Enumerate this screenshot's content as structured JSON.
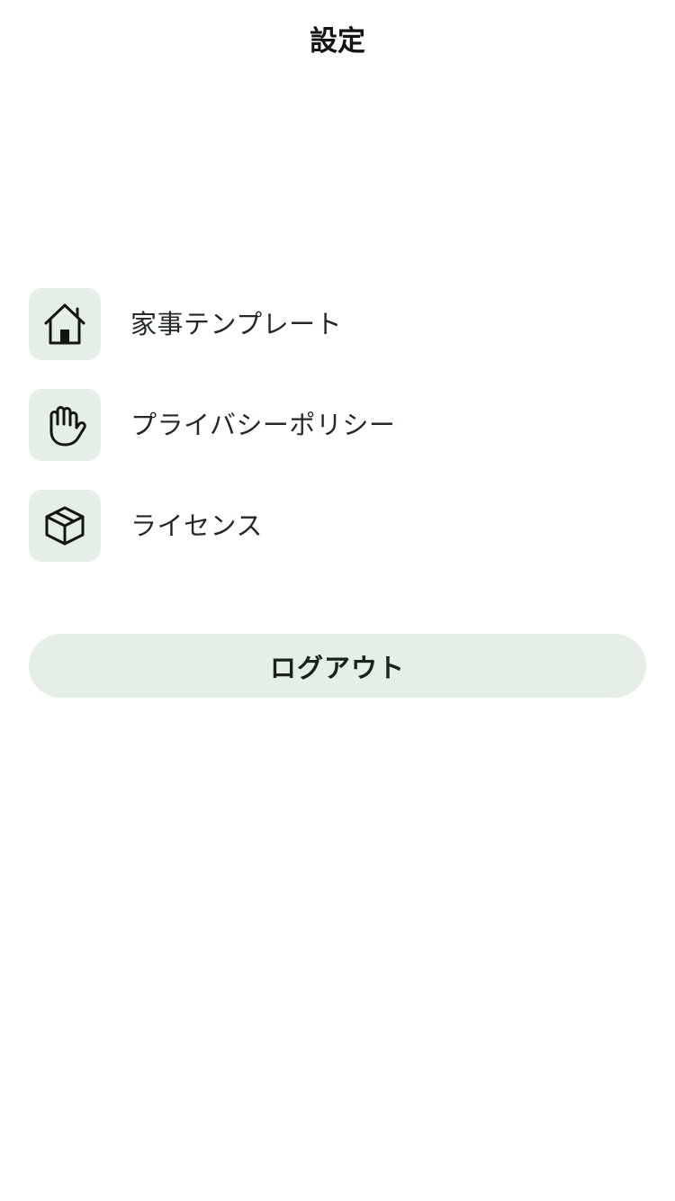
{
  "header": {
    "title": "設定"
  },
  "menu": {
    "items": [
      {
        "label": "家事テンプレート",
        "icon": "house-icon"
      },
      {
        "label": "プライバシーポリシー",
        "icon": "hand-icon"
      },
      {
        "label": "ライセンス",
        "icon": "package-icon"
      }
    ]
  },
  "logout": {
    "label": "ログアウト"
  },
  "colors": {
    "background": "#ffffff",
    "accent_surface": "#e6efe7",
    "text": "#1c241c"
  }
}
